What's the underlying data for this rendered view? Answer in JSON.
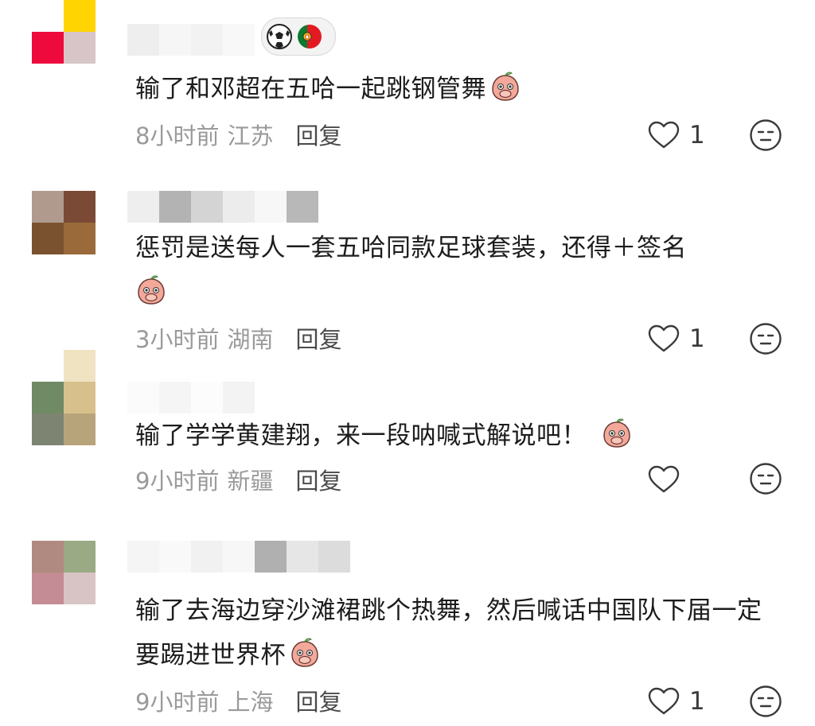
{
  "comments": [
    {
      "text": "输了和邓超在五哈一起跳钢管舞",
      "time": "8小时前",
      "location": "江苏",
      "reply_label": "回复",
      "likes": "1",
      "badge": [
        "soccer-ball-icon",
        "portugal-flag-icon"
      ]
    },
    {
      "text": "惩罚是送每人一套五哈同款足球套装，还得＋签名",
      "time": "3小时前",
      "location": "湖南",
      "reply_label": "回复",
      "likes": "1"
    },
    {
      "text": "输了学学黄建翔，来一段呐喊式解说吧！",
      "time": "9小时前",
      "location": "新疆",
      "reply_label": "回复",
      "likes": ""
    },
    {
      "text": "输了去海边穿沙滩裙跳个热舞，然后喊话中国队下届一定要踢进世界杯",
      "time": "9小时前",
      "location": "上海",
      "reply_label": "回复",
      "likes": "1"
    }
  ],
  "colors": {
    "meta_gray": "#9a9a9a",
    "reply_dark": "#4a4a4a",
    "text": "#1c1c1c",
    "emoji_peach": "#f3a89a"
  },
  "icons": {
    "like": "heart-outline-icon",
    "dislike": "unamused-face-icon",
    "emoji": "peach-cover-mouth-emoji-icon"
  }
}
